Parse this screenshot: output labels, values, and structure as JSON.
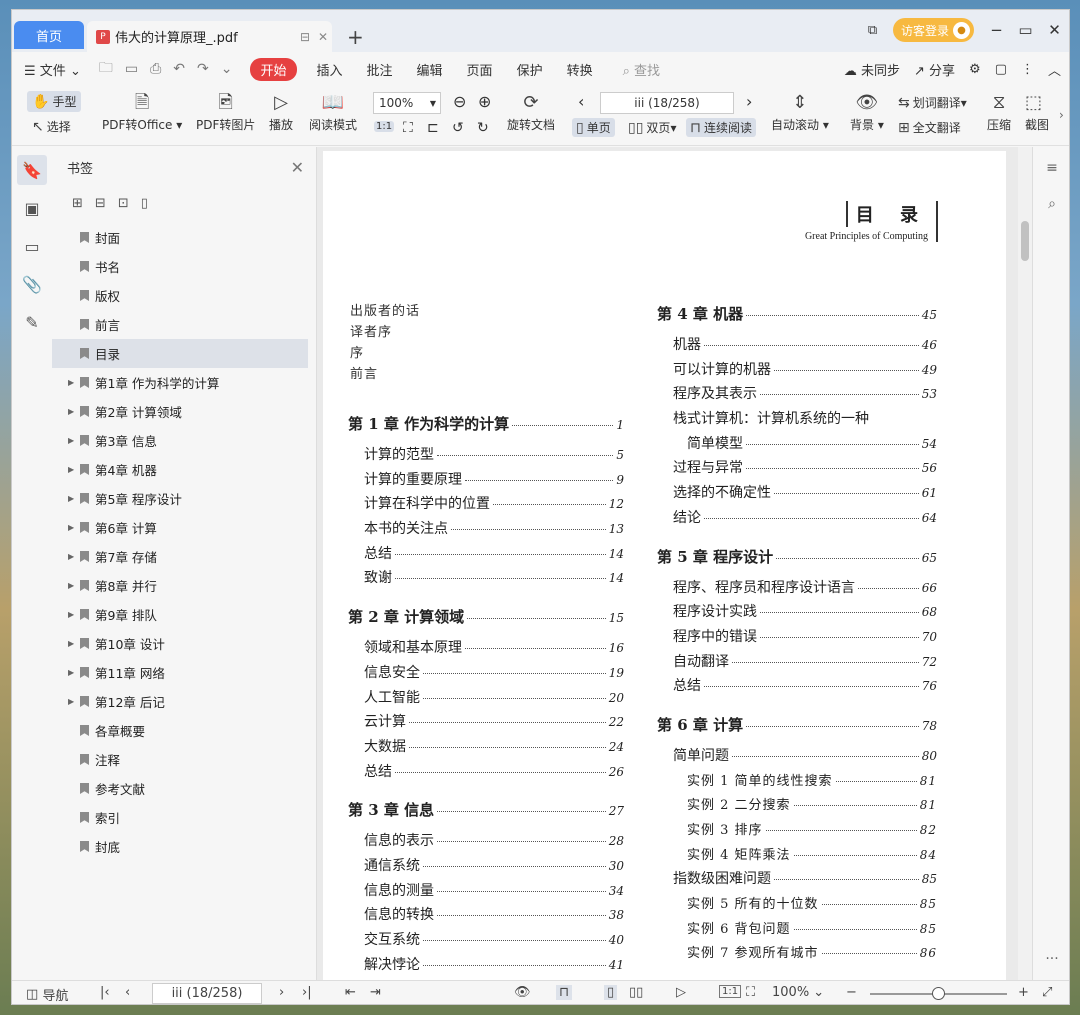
{
  "tabs": {
    "home": "首页",
    "doc": "伟大的计算原理_.pdf",
    "add": "+"
  },
  "window": {
    "login": "访客登录",
    "minimize": "−",
    "restore": "▭",
    "close": "✕"
  },
  "menu": {
    "file": "文件",
    "start": "开始",
    "items": [
      "插入",
      "批注",
      "编辑",
      "页面",
      "保护",
      "转换"
    ],
    "search": "查找",
    "sync": "未同步",
    "share": "分享"
  },
  "toolbar": {
    "hand": "手型",
    "select": "选择",
    "pdf_office": "PDF转Office",
    "pdf_image": "PDF转图片",
    "play": "播放",
    "read_mode": "阅读模式",
    "zoom": "100%",
    "rotate": "旋转文档",
    "page_indicator": "iii (18/258)",
    "single": "单页",
    "double": "双页",
    "continuous": "连续阅读",
    "autoscroll": "自动滚动",
    "background": "背景",
    "word_translate": "划词翻译",
    "full_translate": "全文翻译",
    "compress": "压缩",
    "screenshot": "截图"
  },
  "bookmarks": {
    "title": "书签",
    "items": [
      {
        "label": "封面",
        "expand": false,
        "selected": false
      },
      {
        "label": "书名",
        "expand": false,
        "selected": false
      },
      {
        "label": "版权",
        "expand": false,
        "selected": false
      },
      {
        "label": "前言",
        "expand": false,
        "selected": false
      },
      {
        "label": "目录",
        "expand": false,
        "selected": true
      },
      {
        "label": "第1章  作为科学的计算",
        "expand": true,
        "selected": false
      },
      {
        "label": "第2章  计算领域",
        "expand": true,
        "selected": false
      },
      {
        "label": "第3章  信息",
        "expand": true,
        "selected": false
      },
      {
        "label": "第4章  机器",
        "expand": true,
        "selected": false
      },
      {
        "label": "第5章  程序设计",
        "expand": true,
        "selected": false
      },
      {
        "label": "第6章  计算",
        "expand": true,
        "selected": false
      },
      {
        "label": "第7章  存储",
        "expand": true,
        "selected": false
      },
      {
        "label": "第8章  并行",
        "expand": true,
        "selected": false
      },
      {
        "label": "第9章  排队",
        "expand": true,
        "selected": false
      },
      {
        "label": "第10章  设计",
        "expand": true,
        "selected": false
      },
      {
        "label": "第11章  网络",
        "expand": true,
        "selected": false
      },
      {
        "label": "第12章  后记",
        "expand": true,
        "selected": false
      },
      {
        "label": "各章概要",
        "expand": false,
        "selected": false
      },
      {
        "label": "注释",
        "expand": false,
        "selected": false
      },
      {
        "label": "参考文献",
        "expand": false,
        "selected": false
      },
      {
        "label": "索引",
        "expand": false,
        "selected": false
      },
      {
        "label": "封底",
        "expand": false,
        "selected": false
      }
    ]
  },
  "page": {
    "header_cn": "目 录",
    "header_en": "Great Principles of Computing",
    "front_matter": [
      "出版者的话",
      "译者序",
      "序",
      "前言"
    ],
    "left": [
      {
        "type": "ch",
        "text": "第 1 章   作为科学的计算",
        "page": "1"
      },
      {
        "type": "e",
        "text": "计算的范型",
        "page": "5"
      },
      {
        "type": "e",
        "text": "计算的重要原理",
        "page": "9"
      },
      {
        "type": "e",
        "text": "计算在科学中的位置",
        "page": "12"
      },
      {
        "type": "e",
        "text": "本书的关注点",
        "page": "13"
      },
      {
        "type": "e",
        "text": "总结",
        "page": "14"
      },
      {
        "type": "e",
        "text": "致谢",
        "page": "14"
      },
      {
        "type": "gap"
      },
      {
        "type": "ch",
        "text": "第 2 章   计算领域",
        "page": "15"
      },
      {
        "type": "e",
        "text": "领域和基本原理",
        "page": "16"
      },
      {
        "type": "e",
        "text": "信息安全",
        "page": "19"
      },
      {
        "type": "e",
        "text": "人工智能",
        "page": "20"
      },
      {
        "type": "e",
        "text": "云计算",
        "page": "22"
      },
      {
        "type": "e",
        "text": "大数据",
        "page": "24"
      },
      {
        "type": "e",
        "text": "总结",
        "page": "26"
      },
      {
        "type": "gap"
      },
      {
        "type": "ch",
        "text": "第 3 章   信息",
        "page": "27"
      },
      {
        "type": "e",
        "text": "信息的表示",
        "page": "28"
      },
      {
        "type": "e",
        "text": "通信系统",
        "page": "30"
      },
      {
        "type": "e",
        "text": "信息的测量",
        "page": "34"
      },
      {
        "type": "e",
        "text": "信息的转换",
        "page": "38"
      },
      {
        "type": "e",
        "text": "交互系统",
        "page": "40"
      },
      {
        "type": "e",
        "text": "解决悖论",
        "page": "41"
      }
    ],
    "right": [
      {
        "type": "ch",
        "text": "第 4 章   机器",
        "page": "45"
      },
      {
        "type": "e",
        "text": "机器",
        "page": "46"
      },
      {
        "type": "e",
        "text": "可以计算的机器",
        "page": "49"
      },
      {
        "type": "e",
        "text": "程序及其表示",
        "page": "53"
      },
      {
        "type": "plain",
        "text": "栈式计算机：计算机系统的一种"
      },
      {
        "type": "e2",
        "text": "简单模型",
        "page": "54"
      },
      {
        "type": "e",
        "text": "过程与异常",
        "page": "56"
      },
      {
        "type": "e",
        "text": "选择的不确定性",
        "page": "61"
      },
      {
        "type": "e",
        "text": "结论",
        "page": "64"
      },
      {
        "type": "gap"
      },
      {
        "type": "ch",
        "text": "第 5 章   程序设计",
        "page": "65"
      },
      {
        "type": "e",
        "text": "程序、程序员和程序设计语言",
        "page": "66"
      },
      {
        "type": "e",
        "text": "程序设计实践",
        "page": "68"
      },
      {
        "type": "e",
        "text": "程序中的错误",
        "page": "70"
      },
      {
        "type": "e",
        "text": "自动翻译",
        "page": "72"
      },
      {
        "type": "e",
        "text": "总结",
        "page": "76"
      },
      {
        "type": "gap"
      },
      {
        "type": "ch",
        "text": "第 6 章   计算",
        "page": "78"
      },
      {
        "type": "e",
        "text": "简单问题",
        "page": "80"
      },
      {
        "type": "s",
        "text": "实例 1   简单的线性搜索",
        "page": "81"
      },
      {
        "type": "s",
        "text": "实例 2   二分搜索",
        "page": "81"
      },
      {
        "type": "s",
        "text": "实例 3   排序",
        "page": "82"
      },
      {
        "type": "s",
        "text": "实例 4   矩阵乘法",
        "page": "84"
      },
      {
        "type": "e",
        "text": "指数级困难问题",
        "page": "85"
      },
      {
        "type": "s",
        "text": "实例 5   所有的十位数",
        "page": "85"
      },
      {
        "type": "s",
        "text": "实例 6   背包问题",
        "page": "85"
      },
      {
        "type": "s",
        "text": "实例 7   参观所有城市",
        "page": "86"
      }
    ]
  },
  "status": {
    "nav": "导航",
    "page_indicator": "iii (18/258)",
    "zoom": "100%"
  }
}
